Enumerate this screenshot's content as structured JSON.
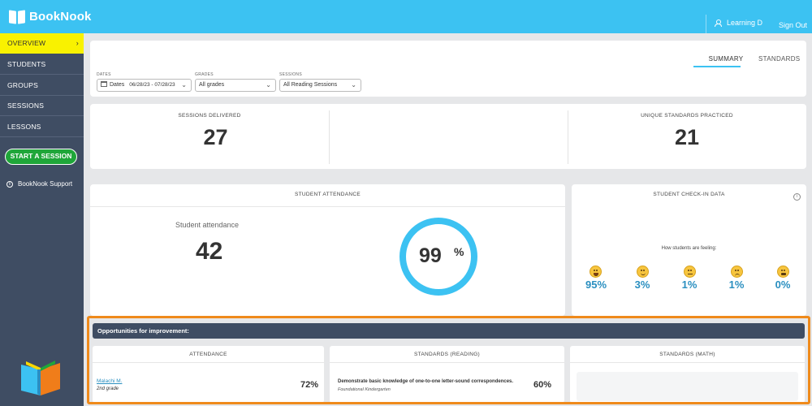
{
  "header": {
    "app_name": "BookNook",
    "user_label": "Learning D",
    "signout_label": "Sign Out",
    "accent_color": "#3cc2f2"
  },
  "sidebar": {
    "items": [
      {
        "label": "OVERVIEW",
        "active": true
      },
      {
        "label": "STUDENTS",
        "active": false
      },
      {
        "label": "GROUPS",
        "active": false
      },
      {
        "label": "SESSIONS",
        "active": false
      },
      {
        "label": "LESSONS",
        "active": false
      }
    ],
    "active_chevron": "›",
    "start_session_label": "START A SESSION",
    "support_label": "BookNook Support",
    "background_color": "#3f4d63",
    "active_color": "#f9f200"
  },
  "tabs": [
    {
      "label": "SUMMARY",
      "active": true
    },
    {
      "label": "STANDARDS",
      "active": false
    }
  ],
  "filters": {
    "dates": {
      "label": "DATES",
      "prefix": "Dates",
      "value": "06/28/23 - 07/28/23"
    },
    "grades": {
      "label": "GRADES",
      "value": "All grades"
    },
    "sessions": {
      "label": "SESSIONS",
      "value": "All Reading Sessions"
    }
  },
  "stats": {
    "sessions_delivered": {
      "label": "SESSIONS DELIVERED",
      "value": "27"
    },
    "unique_standards": {
      "label": "UNIQUE STANDARDS PRACTICED",
      "value": "21"
    }
  },
  "attendance": {
    "title": "STUDENT ATTENDANCE",
    "label": "Student attendance",
    "count": "42",
    "percent": "99",
    "percent_symbol": "%"
  },
  "checkin": {
    "title": "STUDENT CHECK-IN DATA",
    "info_icon": "i",
    "feeling_label": "How students are feeling:",
    "moods": [
      {
        "icon": "very-happy-face-icon",
        "value": "95%"
      },
      {
        "icon": "smiling-face-icon",
        "value": "3%"
      },
      {
        "icon": "neutral-face-icon",
        "value": "1%"
      },
      {
        "icon": "worried-face-icon",
        "value": "1%"
      },
      {
        "icon": "upset-face-icon",
        "value": "0%"
      }
    ]
  },
  "opportunities": {
    "title": "Opportunities for improvement:",
    "highlight_color": "#ef8a1b",
    "attendance": {
      "title": "ATTENDANCE",
      "student_name": "Malachi M.",
      "student_grade": "2nd grade",
      "percent": "72%"
    },
    "standards_reading": {
      "title": "STANDARDS (READING)",
      "description": "Demonstrate basic knowledge of one-to-one letter-sound correspondences.",
      "subtitle": "Foundational Kindergarten",
      "percent": "60%"
    },
    "standards_math": {
      "title": "STANDARDS (MATH)"
    }
  }
}
